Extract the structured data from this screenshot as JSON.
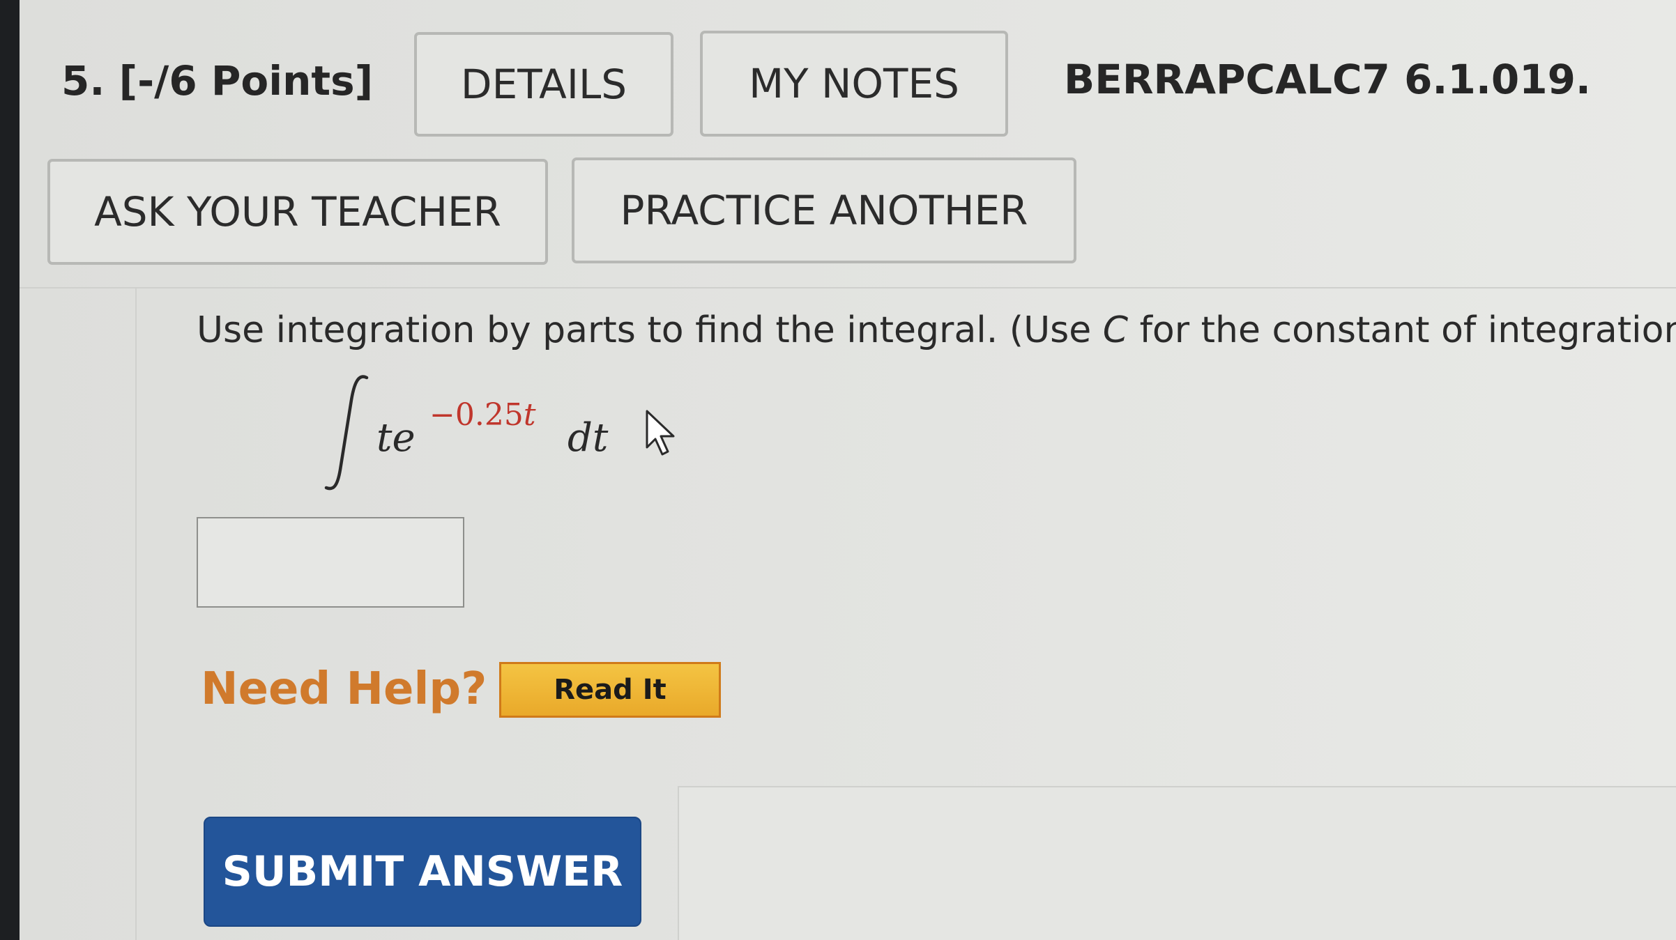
{
  "header": {
    "question_number": "5.",
    "points": "[-/6 Points]",
    "details_label": "DETAILS",
    "my_notes_label": "MY NOTES",
    "problem_code": "BERRAPCALC7 6.1.019.",
    "ask_teacher_label": "ASK YOUR TEACHER",
    "practice_another_label": "PRACTICE ANOTHER"
  },
  "question": {
    "instruction_before": "Use integration by parts to find the integral. (Use ",
    "instruction_var": "C",
    "instruction_after": " for the constant of integration.)",
    "integrand_base": "te",
    "exponent_coefficient": "−0.25",
    "exponent_var": "t",
    "differential": "dt"
  },
  "answer": {
    "value": "",
    "placeholder": ""
  },
  "help": {
    "label": "Need Help?",
    "read_it_label": "Read It"
  },
  "submit": {
    "label": "SUBMIT ANSWER"
  },
  "colors": {
    "submit_bg": "#23559a",
    "help_text": "#d07a2c",
    "read_it_bg": "#f0b835",
    "exponent_text": "#c0362c"
  },
  "icons": {
    "integral": "integral-sign-icon",
    "cursor": "mouse-pointer-icon"
  }
}
